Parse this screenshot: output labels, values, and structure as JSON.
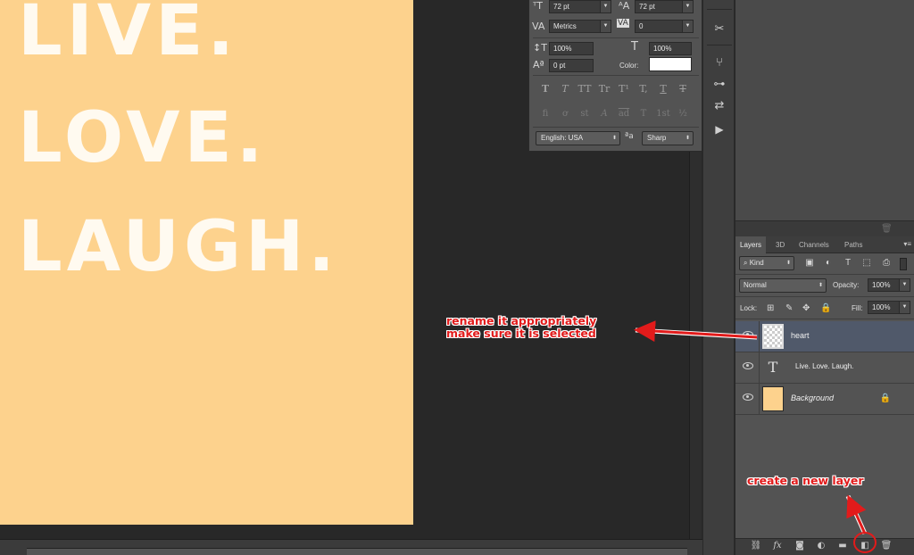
{
  "canvas": {
    "lines": [
      "LIVE.",
      "LOVE.",
      "LAUGH."
    ],
    "background_color": "#fdd28d"
  },
  "character_panel": {
    "font_size": "72 pt",
    "leading": "72 pt",
    "kerning": "Metrics",
    "tracking": "0",
    "vertical_scale": "100%",
    "horizontal_scale": "100%",
    "baseline_shift": "0 pt",
    "color_label": "Color:",
    "color_value": "#ffffff",
    "style_buttons": [
      "T",
      "T",
      "TT",
      "Tr",
      "T¹",
      "T,",
      "T",
      "T"
    ],
    "opentype_buttons": [
      "fi",
      "ơ",
      "st",
      "A",
      "ad",
      "T",
      "1st",
      "½"
    ],
    "language": "English: USA",
    "aa_icon": "ªa",
    "antialias": "Sharp"
  },
  "tools": [
    "brush-settings-icon",
    "clone-source-icon",
    "adjustments-icon",
    "properties-icon",
    "actions-icon",
    "play-icon"
  ],
  "layers_panel": {
    "tabs": [
      "Layers",
      "3D",
      "Channels",
      "Paths"
    ],
    "active_tab": "Layers",
    "filter_kind": "Kind",
    "blend_mode": "Normal",
    "opacity_label": "Opacity:",
    "opacity_value": "100%",
    "lock_label": "Lock:",
    "fill_label": "Fill:",
    "fill_value": "100%",
    "layers": [
      {
        "name": "heart",
        "type": "pixel",
        "selected": true
      },
      {
        "name": "Live. Love. Laugh.",
        "type": "text",
        "selected": false
      },
      {
        "name": "Background",
        "type": "background",
        "selected": false,
        "locked": true
      }
    ],
    "footer_icons": [
      "link-icon",
      "fx-icon",
      "mask-icon",
      "adjustment-layer-icon",
      "group-folder-icon",
      "new-layer-icon",
      "trash-icon"
    ]
  },
  "annotations": {
    "rename_line1": "rename it appropriately",
    "rename_line2": "make sure it is selected",
    "new_layer": "create a new layer",
    "color": "#e21b1b"
  }
}
